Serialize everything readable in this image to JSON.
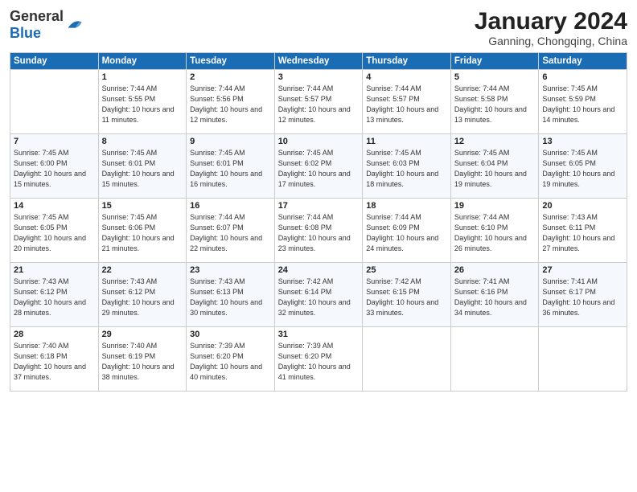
{
  "logo": {
    "general": "General",
    "blue": "Blue"
  },
  "title": {
    "month_year": "January 2024",
    "location": "Ganning, Chongqing, China"
  },
  "weekdays": [
    "Sunday",
    "Monday",
    "Tuesday",
    "Wednesday",
    "Thursday",
    "Friday",
    "Saturday"
  ],
  "weeks": [
    [
      {
        "day": "",
        "sunrise": "",
        "sunset": "",
        "daylight": ""
      },
      {
        "day": "1",
        "sunrise": "Sunrise: 7:44 AM",
        "sunset": "Sunset: 5:55 PM",
        "daylight": "Daylight: 10 hours and 11 minutes."
      },
      {
        "day": "2",
        "sunrise": "Sunrise: 7:44 AM",
        "sunset": "Sunset: 5:56 PM",
        "daylight": "Daylight: 10 hours and 12 minutes."
      },
      {
        "day": "3",
        "sunrise": "Sunrise: 7:44 AM",
        "sunset": "Sunset: 5:57 PM",
        "daylight": "Daylight: 10 hours and 12 minutes."
      },
      {
        "day": "4",
        "sunrise": "Sunrise: 7:44 AM",
        "sunset": "Sunset: 5:57 PM",
        "daylight": "Daylight: 10 hours and 13 minutes."
      },
      {
        "day": "5",
        "sunrise": "Sunrise: 7:44 AM",
        "sunset": "Sunset: 5:58 PM",
        "daylight": "Daylight: 10 hours and 13 minutes."
      },
      {
        "day": "6",
        "sunrise": "Sunrise: 7:45 AM",
        "sunset": "Sunset: 5:59 PM",
        "daylight": "Daylight: 10 hours and 14 minutes."
      }
    ],
    [
      {
        "day": "7",
        "sunrise": "Sunrise: 7:45 AM",
        "sunset": "Sunset: 6:00 PM",
        "daylight": "Daylight: 10 hours and 15 minutes."
      },
      {
        "day": "8",
        "sunrise": "Sunrise: 7:45 AM",
        "sunset": "Sunset: 6:01 PM",
        "daylight": "Daylight: 10 hours and 15 minutes."
      },
      {
        "day": "9",
        "sunrise": "Sunrise: 7:45 AM",
        "sunset": "Sunset: 6:01 PM",
        "daylight": "Daylight: 10 hours and 16 minutes."
      },
      {
        "day": "10",
        "sunrise": "Sunrise: 7:45 AM",
        "sunset": "Sunset: 6:02 PM",
        "daylight": "Daylight: 10 hours and 17 minutes."
      },
      {
        "day": "11",
        "sunrise": "Sunrise: 7:45 AM",
        "sunset": "Sunset: 6:03 PM",
        "daylight": "Daylight: 10 hours and 18 minutes."
      },
      {
        "day": "12",
        "sunrise": "Sunrise: 7:45 AM",
        "sunset": "Sunset: 6:04 PM",
        "daylight": "Daylight: 10 hours and 19 minutes."
      },
      {
        "day": "13",
        "sunrise": "Sunrise: 7:45 AM",
        "sunset": "Sunset: 6:05 PM",
        "daylight": "Daylight: 10 hours and 19 minutes."
      }
    ],
    [
      {
        "day": "14",
        "sunrise": "Sunrise: 7:45 AM",
        "sunset": "Sunset: 6:05 PM",
        "daylight": "Daylight: 10 hours and 20 minutes."
      },
      {
        "day": "15",
        "sunrise": "Sunrise: 7:45 AM",
        "sunset": "Sunset: 6:06 PM",
        "daylight": "Daylight: 10 hours and 21 minutes."
      },
      {
        "day": "16",
        "sunrise": "Sunrise: 7:44 AM",
        "sunset": "Sunset: 6:07 PM",
        "daylight": "Daylight: 10 hours and 22 minutes."
      },
      {
        "day": "17",
        "sunrise": "Sunrise: 7:44 AM",
        "sunset": "Sunset: 6:08 PM",
        "daylight": "Daylight: 10 hours and 23 minutes."
      },
      {
        "day": "18",
        "sunrise": "Sunrise: 7:44 AM",
        "sunset": "Sunset: 6:09 PM",
        "daylight": "Daylight: 10 hours and 24 minutes."
      },
      {
        "day": "19",
        "sunrise": "Sunrise: 7:44 AM",
        "sunset": "Sunset: 6:10 PM",
        "daylight": "Daylight: 10 hours and 26 minutes."
      },
      {
        "day": "20",
        "sunrise": "Sunrise: 7:43 AM",
        "sunset": "Sunset: 6:11 PM",
        "daylight": "Daylight: 10 hours and 27 minutes."
      }
    ],
    [
      {
        "day": "21",
        "sunrise": "Sunrise: 7:43 AM",
        "sunset": "Sunset: 6:12 PM",
        "daylight": "Daylight: 10 hours and 28 minutes."
      },
      {
        "day": "22",
        "sunrise": "Sunrise: 7:43 AM",
        "sunset": "Sunset: 6:12 PM",
        "daylight": "Daylight: 10 hours and 29 minutes."
      },
      {
        "day": "23",
        "sunrise": "Sunrise: 7:43 AM",
        "sunset": "Sunset: 6:13 PM",
        "daylight": "Daylight: 10 hours and 30 minutes."
      },
      {
        "day": "24",
        "sunrise": "Sunrise: 7:42 AM",
        "sunset": "Sunset: 6:14 PM",
        "daylight": "Daylight: 10 hours and 32 minutes."
      },
      {
        "day": "25",
        "sunrise": "Sunrise: 7:42 AM",
        "sunset": "Sunset: 6:15 PM",
        "daylight": "Daylight: 10 hours and 33 minutes."
      },
      {
        "day": "26",
        "sunrise": "Sunrise: 7:41 AM",
        "sunset": "Sunset: 6:16 PM",
        "daylight": "Daylight: 10 hours and 34 minutes."
      },
      {
        "day": "27",
        "sunrise": "Sunrise: 7:41 AM",
        "sunset": "Sunset: 6:17 PM",
        "daylight": "Daylight: 10 hours and 36 minutes."
      }
    ],
    [
      {
        "day": "28",
        "sunrise": "Sunrise: 7:40 AM",
        "sunset": "Sunset: 6:18 PM",
        "daylight": "Daylight: 10 hours and 37 minutes."
      },
      {
        "day": "29",
        "sunrise": "Sunrise: 7:40 AM",
        "sunset": "Sunset: 6:19 PM",
        "daylight": "Daylight: 10 hours and 38 minutes."
      },
      {
        "day": "30",
        "sunrise": "Sunrise: 7:39 AM",
        "sunset": "Sunset: 6:20 PM",
        "daylight": "Daylight: 10 hours and 40 minutes."
      },
      {
        "day": "31",
        "sunrise": "Sunrise: 7:39 AM",
        "sunset": "Sunset: 6:20 PM",
        "daylight": "Daylight: 10 hours and 41 minutes."
      },
      {
        "day": "",
        "sunrise": "",
        "sunset": "",
        "daylight": ""
      },
      {
        "day": "",
        "sunrise": "",
        "sunset": "",
        "daylight": ""
      },
      {
        "day": "",
        "sunrise": "",
        "sunset": "",
        "daylight": ""
      }
    ]
  ]
}
